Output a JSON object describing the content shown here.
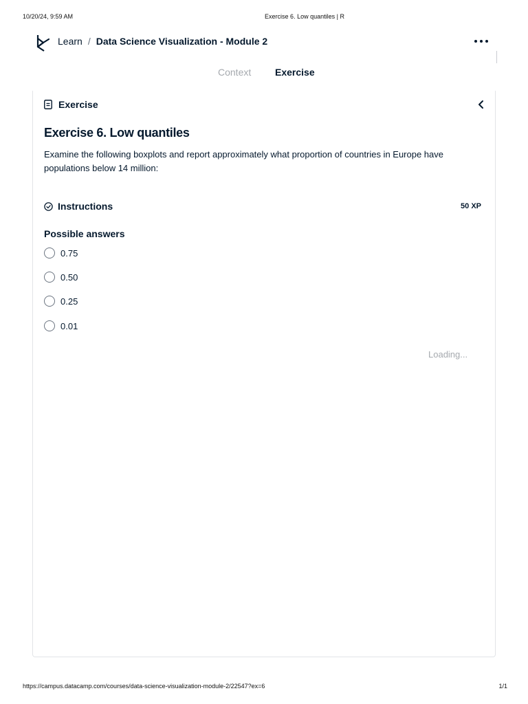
{
  "print": {
    "datetime": "10/20/24, 9:59 AM",
    "doc_title": "Exercise 6. Low quantiles | R",
    "url": "https://campus.datacamp.com/courses/data-science-visualization-module-2/22547?ex=6",
    "page_count": "1/1"
  },
  "breadcrumb": {
    "learn": "Learn",
    "separator": "/",
    "course": "Data Science Visualization - Module 2"
  },
  "tabs": {
    "context": "Context",
    "exercise": "Exercise"
  },
  "panel": {
    "header": "Exercise",
    "title": "Exercise 6. Low quantiles",
    "description": "Examine the following boxplots and report approximately what proportion of countries in Europe have populations below 14 million:",
    "instructions_label": "Instructions",
    "xp": "50 XP",
    "answers_label": "Possible answers",
    "answers": [
      "0.75",
      "0.50",
      "0.25",
      "0.01"
    ],
    "loading": "Loading..."
  },
  "colors": {
    "text": "#05192d",
    "muted": "#a5a9ae",
    "border": "#e2e4e7"
  },
  "icons": [
    "datacamp-logo-icon",
    "more-options-icon",
    "document-icon",
    "chevron-left-icon",
    "check-circle-icon"
  ]
}
